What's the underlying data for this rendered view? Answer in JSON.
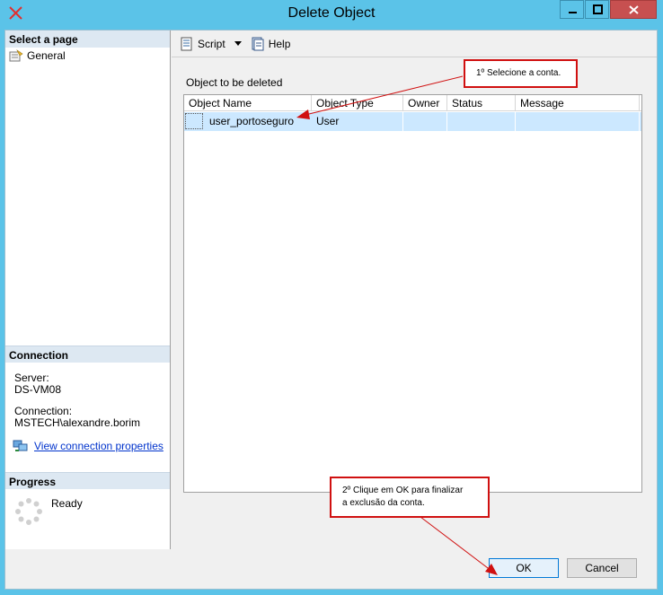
{
  "window": {
    "title": "Delete Object",
    "minimize_glyph": "━",
    "maximize_glyph": "□",
    "close_glyph": "x"
  },
  "left": {
    "select_page_heading": "Select a page",
    "pages": [
      {
        "label": "General",
        "icon": "general-page-icon"
      }
    ],
    "connection_heading": "Connection",
    "server_label": "Server:",
    "server_value": "DS-VM08",
    "connection_label": "Connection:",
    "connection_value": "MSTECH\\alexandre.borim",
    "view_connection_link": "View connection properties",
    "progress_heading": "Progress",
    "progress_status": "Ready"
  },
  "toolbar": {
    "script_label": "Script",
    "help_label": "Help"
  },
  "main": {
    "object_label": "Object to be deleted",
    "columns": [
      "Object Name",
      "Object Type",
      "Owner",
      "Status",
      "Message"
    ],
    "rows": [
      {
        "name": "user_portoseguro",
        "type": "User",
        "owner": "",
        "status": "",
        "message": ""
      }
    ]
  },
  "annotations": {
    "step1": "1º Selecione a conta.",
    "step2_line1": "2º Clique em OK para finalizar",
    "step2_line2": "a exclusão da conta."
  },
  "buttons": {
    "ok": "OK",
    "cancel": "Cancel"
  },
  "colors": {
    "titlebar": "#5bc3e8",
    "close_button": "#c75050",
    "selection": "#cce8ff",
    "annotation_border": "#d01010",
    "link": "#0033cc"
  }
}
